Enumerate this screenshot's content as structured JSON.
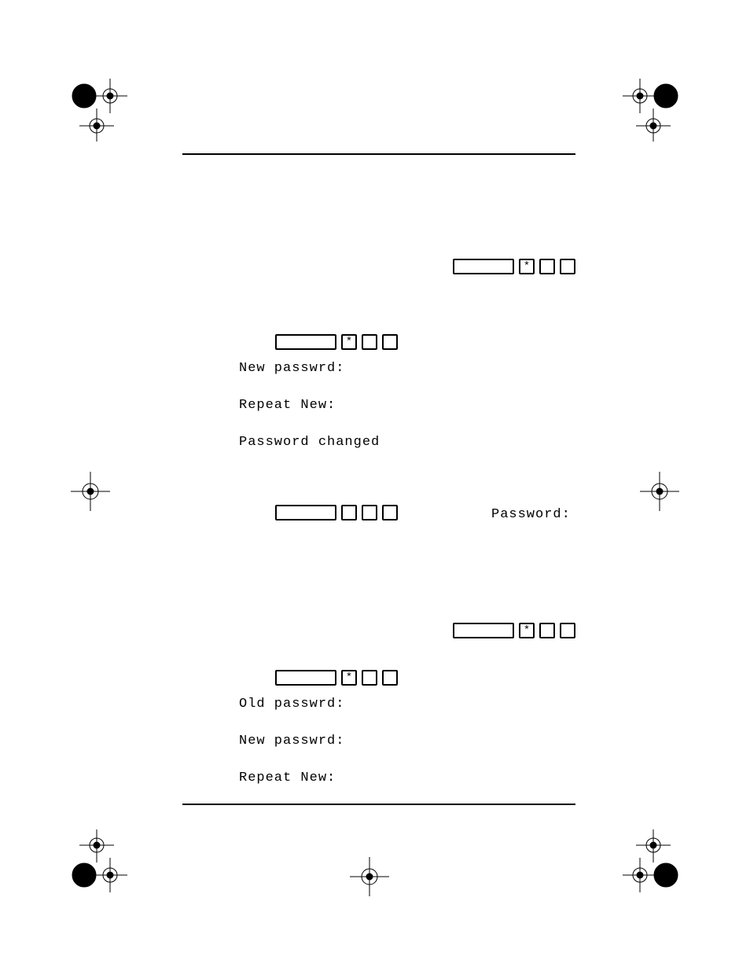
{
  "labels": {
    "new_passwrd": "New passwrd:",
    "repeat_new": "Repeat New:",
    "password_changed": "Password changed",
    "password": "Password:",
    "old_passwrd": "Old passwrd:"
  },
  "glyphs": {
    "star": "*"
  }
}
